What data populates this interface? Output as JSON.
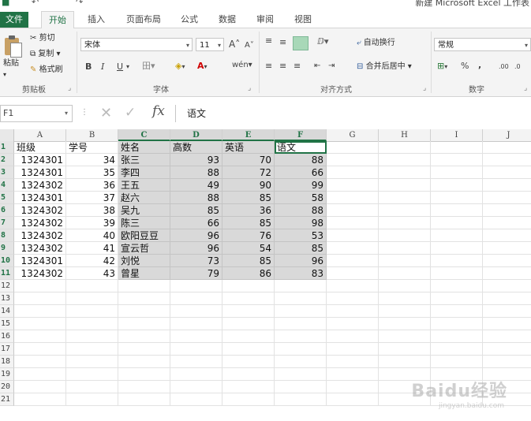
{
  "titlebar": {
    "window_title": "新建 Microsoft Excel 工作表",
    "quick_access": [
      "save-icon",
      "undo-icon",
      "redo-icon"
    ]
  },
  "ribbon_tabs": [
    "文件",
    "开始",
    "插入",
    "页面布局",
    "公式",
    "数据",
    "审阅",
    "视图"
  ],
  "active_tab": "开始",
  "clipboard": {
    "paste": "粘贴",
    "cut": "剪切",
    "copy": "复制",
    "format_painter": "格式刷",
    "group": "剪贴板"
  },
  "font": {
    "name": "宋体",
    "size": "11",
    "grow": "A",
    "shrink": "A",
    "bold": "B",
    "italic": "I",
    "underline": "U",
    "group": "字体",
    "phonetic": "wén"
  },
  "alignment": {
    "wrap_text": "自动换行",
    "merge_center": "合并后居中",
    "group": "对齐方式"
  },
  "number": {
    "format": "常规",
    "percent": "%",
    "comma": ",",
    "inc_decimal": ".00",
    "group": "数字"
  },
  "formula_bar": {
    "name_box": "F1",
    "content": "语文",
    "fx": "fx"
  },
  "columns": [
    "A",
    "B",
    "C",
    "D",
    "E",
    "F",
    "G",
    "H",
    "I",
    "J"
  ],
  "selected_columns": [
    "C",
    "D",
    "E",
    "F"
  ],
  "rows": [
    [
      "班级",
      "学号",
      "姓名",
      "高数",
      "英语",
      "语文"
    ],
    [
      "1324301",
      "34",
      "张三",
      "93",
      "70",
      "88"
    ],
    [
      "1324301",
      "35",
      "李四",
      "88",
      "72",
      "66"
    ],
    [
      "1324302",
      "36",
      "王五",
      "49",
      "90",
      "99"
    ],
    [
      "1324301",
      "37",
      "赵六",
      "88",
      "85",
      "58"
    ],
    [
      "1324302",
      "38",
      "吴九",
      "85",
      "36",
      "88"
    ],
    [
      "1324302",
      "39",
      "陈三",
      "66",
      "85",
      "98"
    ],
    [
      "1324302",
      "40",
      "欧阳豆豆",
      "96",
      "76",
      "53"
    ],
    [
      "1324302",
      "41",
      "宣云哲",
      "96",
      "54",
      "85"
    ],
    [
      "1324301",
      "42",
      "刘悦",
      "73",
      "85",
      "96"
    ],
    [
      "1324302",
      "43",
      "曾星",
      "79",
      "86",
      "83"
    ]
  ],
  "row_numbers": [
    "1",
    "2",
    "3",
    "4",
    "5",
    "6",
    "7",
    "8",
    "9",
    "10",
    "11",
    "12",
    "13",
    "14",
    "15",
    "16",
    "17",
    "18",
    "19",
    "20",
    "21"
  ],
  "watermark": {
    "main": "Baidu经验",
    "sub": "jingyan.baidu.com"
  },
  "colors": {
    "excel_green": "#217346",
    "selection_gray": "#d9d9d9"
  }
}
